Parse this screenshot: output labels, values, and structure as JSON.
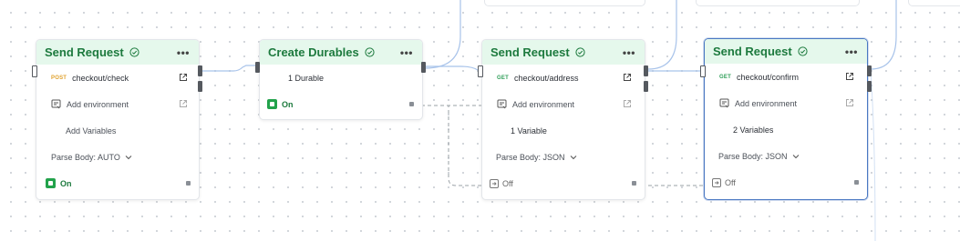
{
  "nodes": [
    {
      "title": "Send Request",
      "method": "POST",
      "path": "checkout/check",
      "env_label": "Add environment",
      "variables_label": "Add Variables",
      "parse_body": "Parse Body: AUTO",
      "status": "On"
    },
    {
      "title": "Create Durables",
      "durables": "1 Durable",
      "status": "On"
    },
    {
      "title": "Send Request",
      "method": "GET",
      "path": "checkout/address",
      "env_label": "Add environment",
      "variables_label": "1 Variable",
      "parse_body": "Parse Body: JSON",
      "status": "Off"
    },
    {
      "title": "Send Request",
      "method": "GET",
      "path": "checkout/confirm",
      "env_label": "Add environment",
      "variables_label": "2 Variables",
      "parse_body": "Parse Body: JSON",
      "status": "Off"
    }
  ],
  "menu_glyph": "•••",
  "colors": {
    "header_bg": "#e5f8ec",
    "title": "#1d7a3e",
    "toggle_on": "#22a24b",
    "method_post": "#e0a22e",
    "method_get": "#2e9e57",
    "wire": "#a8c3ea",
    "selected_border": "#4a78c2"
  },
  "icons": [
    "check-circle-icon",
    "more-icon",
    "external-link-icon",
    "environment-icon",
    "chevron-down-icon",
    "toggle-on-icon",
    "toggle-off-icon"
  ]
}
